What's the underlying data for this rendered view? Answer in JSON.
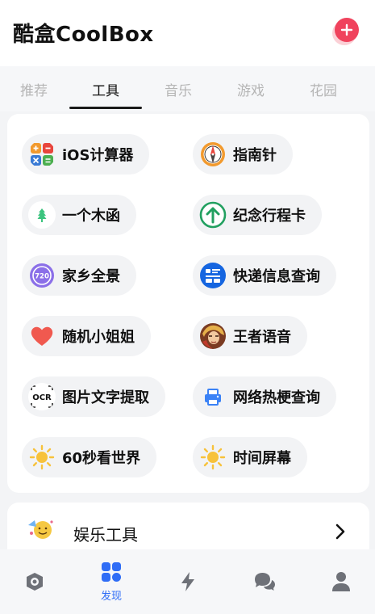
{
  "header": {
    "title": "酷盒CoolBox"
  },
  "tabs": [
    {
      "label": "推荐",
      "active": false
    },
    {
      "label": "工具",
      "active": true
    },
    {
      "label": "音乐",
      "active": false
    },
    {
      "label": "游戏",
      "active": false
    },
    {
      "label": "花园",
      "active": false
    }
  ],
  "tools": [
    {
      "label": "iOS计算器",
      "icon": "calculator-icon"
    },
    {
      "label": "指南针",
      "icon": "compass-icon"
    },
    {
      "label": "一个木函",
      "icon": "tree-icon"
    },
    {
      "label": "纪念行程卡",
      "icon": "arrow-up-circle-icon"
    },
    {
      "label": "家乡全景",
      "icon": "panorama-720-icon"
    },
    {
      "label": "快递信息查询",
      "icon": "express-icon"
    },
    {
      "label": "随机小姐姐",
      "icon": "heart-icon"
    },
    {
      "label": "王者语音",
      "icon": "game-hero-icon"
    },
    {
      "label": "图片文字提取",
      "icon": "ocr-icon"
    },
    {
      "label": "网络热梗查询",
      "icon": "printer-icon"
    },
    {
      "label": "60秒看世界",
      "icon": "sun-icon"
    },
    {
      "label": "时间屏幕",
      "icon": "sun-icon"
    }
  ],
  "entertainment": {
    "label": "娱乐工具"
  },
  "bottom_nav": [
    {
      "icon": "camera-lens-icon",
      "label": ""
    },
    {
      "icon": "discover-grid-icon",
      "label": "发现"
    },
    {
      "icon": "lightning-icon",
      "label": ""
    },
    {
      "icon": "chat-icon",
      "label": ""
    },
    {
      "icon": "user-icon",
      "label": ""
    }
  ],
  "colors": {
    "accent_blue": "#2f6df6",
    "add_button": "#f0435d",
    "pill_bg": "#f2f3f5"
  }
}
